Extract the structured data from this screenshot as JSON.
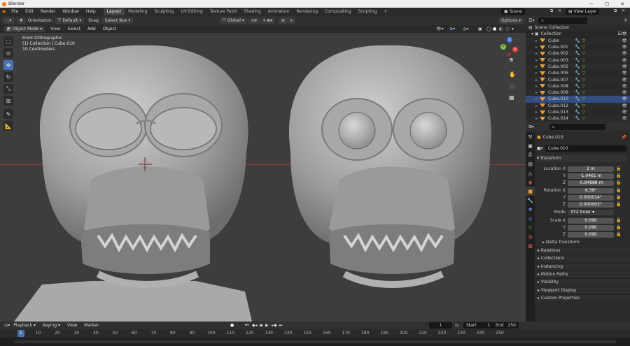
{
  "window": {
    "title": "Blender"
  },
  "menu": [
    "File",
    "Edit",
    "Render",
    "Window",
    "Help"
  ],
  "workspaces": [
    {
      "label": "Layout",
      "active": true
    },
    {
      "label": "Modeling"
    },
    {
      "label": "Sculpting"
    },
    {
      "label": "UV Editing"
    },
    {
      "label": "Texture Paint"
    },
    {
      "label": "Shading"
    },
    {
      "label": "Animation"
    },
    {
      "label": "Rendering"
    },
    {
      "label": "Compositing"
    },
    {
      "label": "Scripting"
    }
  ],
  "scene": {
    "name": "Scene",
    "view_layer": "View Layer"
  },
  "header": {
    "orientation_label": "Orientation:",
    "orientation_value": "Default",
    "drag_label": "Drag:",
    "drag_value": "Select Box",
    "transform_orientation": "Global",
    "options_label": "Options"
  },
  "viewport_menu": {
    "mode": "Object Mode",
    "items": [
      "View",
      "Select",
      "Add",
      "Object"
    ]
  },
  "viewport_info": {
    "view_name": "Front Orthographic",
    "collection_line": "(1) Collection | Cube.010",
    "scale_text": "10 Centimeters"
  },
  "gizmo": {
    "z": "Z",
    "y": "Y",
    "x": "X"
  },
  "outliner": {
    "root": "Scene Collection",
    "collection": "Collection",
    "items": [
      "Cube",
      "Cube.001",
      "Cube.002",
      "Cube.003",
      "Cube.005",
      "Cube.006",
      "Cube.007",
      "Cube.008",
      "Cube.009",
      "Cube.010",
      "Cube.012",
      "Cube.013",
      "Cube.014"
    ],
    "selected": "Cube.010"
  },
  "properties": {
    "object_name": "Cube.010",
    "datablock_name": "Cube.010",
    "transform_title": "Transform",
    "location": {
      "label": "Location X",
      "x": "2 m",
      "y": "-1.0461 m",
      "z": "-0.84888 m"
    },
    "rotation": {
      "label": "Rotation X",
      "x": "6.39°",
      "y": "0.000014°",
      "z": "0.000003°"
    },
    "mode_label": "Mode",
    "mode_value": "XYZ Euler",
    "scale": {
      "label": "Scale X",
      "x": "0.090",
      "y": "0.090",
      "z": "0.090"
    },
    "axis_y": "Y",
    "axis_z": "Z",
    "delta_transform": "Delta Transform",
    "panels": [
      "Relations",
      "Collections",
      "Instancing",
      "Motion Paths",
      "Visibility",
      "Viewport Display",
      "Custom Properties"
    ]
  },
  "timeline": {
    "menus": [
      "Playback",
      "Keying",
      "View",
      "Marker"
    ],
    "current_frame": "1",
    "start_label": "Start",
    "start_value": "1",
    "end_label": "End",
    "end_value": "250",
    "ticks": [
      "0",
      "10",
      "20",
      "30",
      "40",
      "50",
      "60",
      "70",
      "80",
      "90",
      "100",
      "110",
      "120",
      "130",
      "140",
      "150",
      "160",
      "170",
      "180",
      "190",
      "200",
      "210",
      "220",
      "230",
      "240",
      "250"
    ],
    "playhead": "1"
  },
  "colors": {
    "accent": "#4772b3",
    "selected_row": "#334d80",
    "mesh_tri": "#e89b3a",
    "x_axis": "#e33b3b",
    "y_axis": "#7ec63c",
    "z_axis": "#3b7ae3"
  }
}
